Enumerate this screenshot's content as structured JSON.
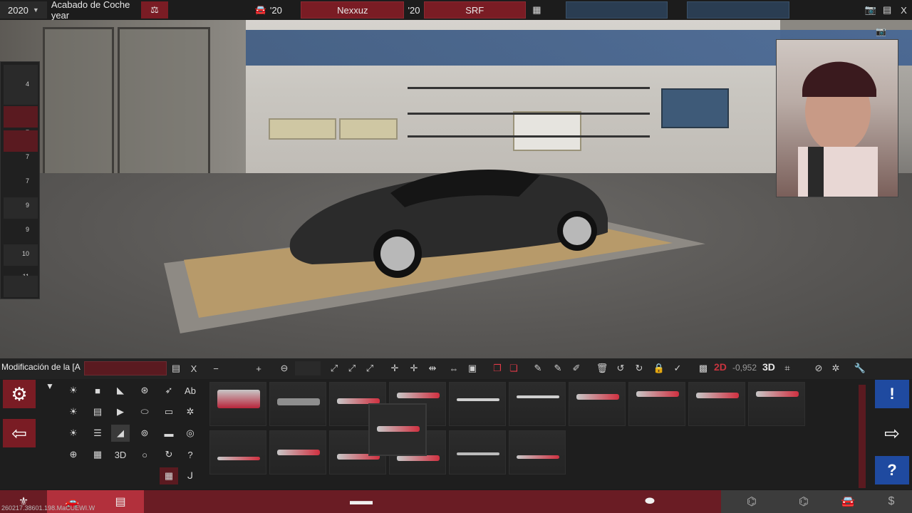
{
  "topbar": {
    "year": "2020",
    "trim": "Acabado de Coche year",
    "year_short_1": "'20",
    "name": "Nexxuz",
    "year_short_2": "'20",
    "trim2": "SRF",
    "camera_icon": "camera-icon",
    "export_icon": "export-icon",
    "close_label": "X"
  },
  "parts_column": {
    "numbers": [
      "4",
      "7",
      "7",
      "7",
      "9",
      "9",
      "10",
      "11"
    ]
  },
  "editor": {
    "mod_label": "Modificación de la [A",
    "name_value": "",
    "close_label": "X",
    "dim_2d": "2D",
    "dim_readout": "-0,952",
    "dim_3d": "3D",
    "filter_3d": "3D",
    "filter_ab": "Ab"
  },
  "status": {
    "version": "260217.38601.198.MaCUEWI.W"
  },
  "colors": {
    "accent_red": "#7a1c24",
    "active_red": "#b2303c",
    "info_blue": "#1f4aa0"
  }
}
